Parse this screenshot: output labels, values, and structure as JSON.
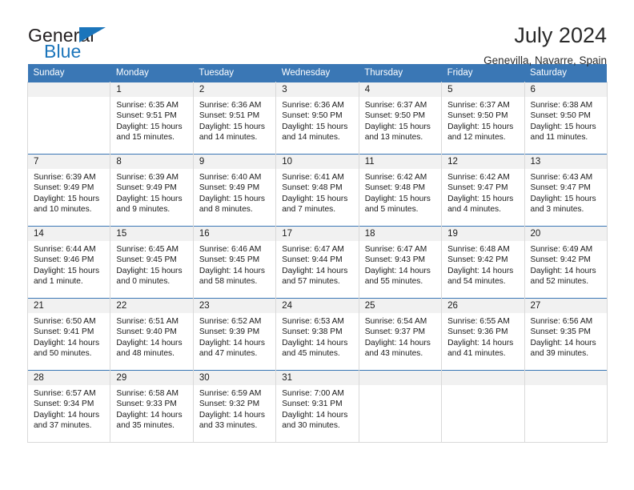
{
  "brand": {
    "word_one": "General",
    "word_two": "Blue",
    "icon": "triangle-logo-mark",
    "color_dark": "#231f20",
    "color_blue": "#1b75bb"
  },
  "header": {
    "title": "July 2024",
    "location": "Genevilla, Navarre, Spain",
    "accent_color": "#3a77b5",
    "daynum_bg": "#f1f1f1"
  },
  "weekdays": [
    "Sunday",
    "Monday",
    "Tuesday",
    "Wednesday",
    "Thursday",
    "Friday",
    "Saturday"
  ],
  "weeks": [
    [
      {
        "day": "",
        "info": ""
      },
      {
        "day": "1",
        "info": "Sunrise: 6:35 AM\nSunset: 9:51 PM\nDaylight: 15 hours\nand 15 minutes."
      },
      {
        "day": "2",
        "info": "Sunrise: 6:36 AM\nSunset: 9:51 PM\nDaylight: 15 hours\nand 14 minutes."
      },
      {
        "day": "3",
        "info": "Sunrise: 6:36 AM\nSunset: 9:50 PM\nDaylight: 15 hours\nand 14 minutes."
      },
      {
        "day": "4",
        "info": "Sunrise: 6:37 AM\nSunset: 9:50 PM\nDaylight: 15 hours\nand 13 minutes."
      },
      {
        "day": "5",
        "info": "Sunrise: 6:37 AM\nSunset: 9:50 PM\nDaylight: 15 hours\nand 12 minutes."
      },
      {
        "day": "6",
        "info": "Sunrise: 6:38 AM\nSunset: 9:50 PM\nDaylight: 15 hours\nand 11 minutes."
      }
    ],
    [
      {
        "day": "7",
        "info": "Sunrise: 6:39 AM\nSunset: 9:49 PM\nDaylight: 15 hours\nand 10 minutes."
      },
      {
        "day": "8",
        "info": "Sunrise: 6:39 AM\nSunset: 9:49 PM\nDaylight: 15 hours\nand 9 minutes."
      },
      {
        "day": "9",
        "info": "Sunrise: 6:40 AM\nSunset: 9:49 PM\nDaylight: 15 hours\nand 8 minutes."
      },
      {
        "day": "10",
        "info": "Sunrise: 6:41 AM\nSunset: 9:48 PM\nDaylight: 15 hours\nand 7 minutes."
      },
      {
        "day": "11",
        "info": "Sunrise: 6:42 AM\nSunset: 9:48 PM\nDaylight: 15 hours\nand 5 minutes."
      },
      {
        "day": "12",
        "info": "Sunrise: 6:42 AM\nSunset: 9:47 PM\nDaylight: 15 hours\nand 4 minutes."
      },
      {
        "day": "13",
        "info": "Sunrise: 6:43 AM\nSunset: 9:47 PM\nDaylight: 15 hours\nand 3 minutes."
      }
    ],
    [
      {
        "day": "14",
        "info": "Sunrise: 6:44 AM\nSunset: 9:46 PM\nDaylight: 15 hours\nand 1 minute."
      },
      {
        "day": "15",
        "info": "Sunrise: 6:45 AM\nSunset: 9:45 PM\nDaylight: 15 hours\nand 0 minutes."
      },
      {
        "day": "16",
        "info": "Sunrise: 6:46 AM\nSunset: 9:45 PM\nDaylight: 14 hours\nand 58 minutes."
      },
      {
        "day": "17",
        "info": "Sunrise: 6:47 AM\nSunset: 9:44 PM\nDaylight: 14 hours\nand 57 minutes."
      },
      {
        "day": "18",
        "info": "Sunrise: 6:47 AM\nSunset: 9:43 PM\nDaylight: 14 hours\nand 55 minutes."
      },
      {
        "day": "19",
        "info": "Sunrise: 6:48 AM\nSunset: 9:42 PM\nDaylight: 14 hours\nand 54 minutes."
      },
      {
        "day": "20",
        "info": "Sunrise: 6:49 AM\nSunset: 9:42 PM\nDaylight: 14 hours\nand 52 minutes."
      }
    ],
    [
      {
        "day": "21",
        "info": "Sunrise: 6:50 AM\nSunset: 9:41 PM\nDaylight: 14 hours\nand 50 minutes."
      },
      {
        "day": "22",
        "info": "Sunrise: 6:51 AM\nSunset: 9:40 PM\nDaylight: 14 hours\nand 48 minutes."
      },
      {
        "day": "23",
        "info": "Sunrise: 6:52 AM\nSunset: 9:39 PM\nDaylight: 14 hours\nand 47 minutes."
      },
      {
        "day": "24",
        "info": "Sunrise: 6:53 AM\nSunset: 9:38 PM\nDaylight: 14 hours\nand 45 minutes."
      },
      {
        "day": "25",
        "info": "Sunrise: 6:54 AM\nSunset: 9:37 PM\nDaylight: 14 hours\nand 43 minutes."
      },
      {
        "day": "26",
        "info": "Sunrise: 6:55 AM\nSunset: 9:36 PM\nDaylight: 14 hours\nand 41 minutes."
      },
      {
        "day": "27",
        "info": "Sunrise: 6:56 AM\nSunset: 9:35 PM\nDaylight: 14 hours\nand 39 minutes."
      }
    ],
    [
      {
        "day": "28",
        "info": "Sunrise: 6:57 AM\nSunset: 9:34 PM\nDaylight: 14 hours\nand 37 minutes."
      },
      {
        "day": "29",
        "info": "Sunrise: 6:58 AM\nSunset: 9:33 PM\nDaylight: 14 hours\nand 35 minutes."
      },
      {
        "day": "30",
        "info": "Sunrise: 6:59 AM\nSunset: 9:32 PM\nDaylight: 14 hours\nand 33 minutes."
      },
      {
        "day": "31",
        "info": "Sunrise: 7:00 AM\nSunset: 9:31 PM\nDaylight: 14 hours\nand 30 minutes."
      },
      {
        "day": "",
        "info": ""
      },
      {
        "day": "",
        "info": ""
      },
      {
        "day": "",
        "info": ""
      }
    ]
  ]
}
